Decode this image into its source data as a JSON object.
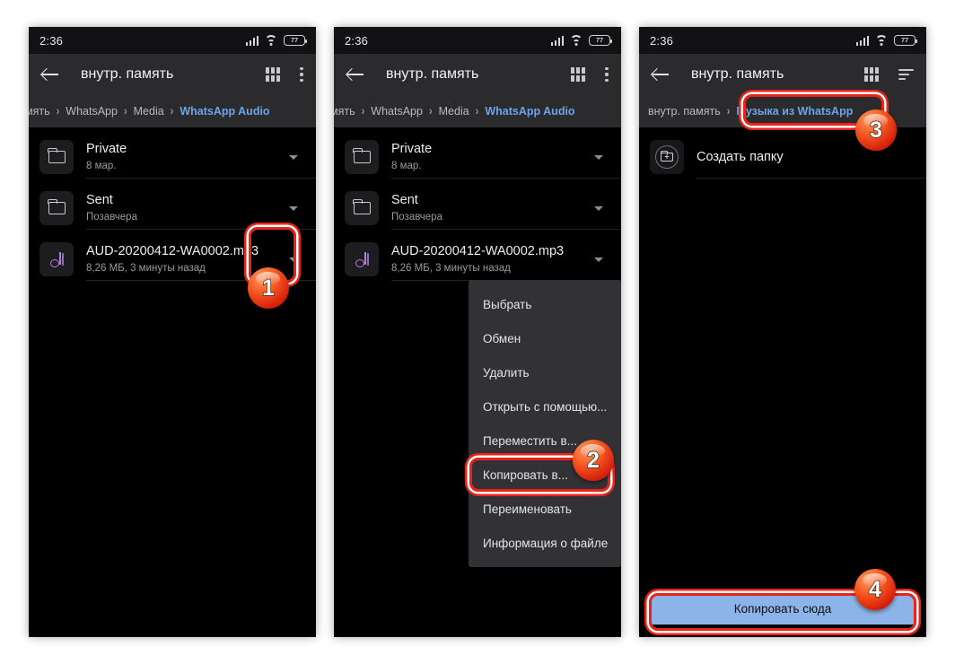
{
  "status_bar": {
    "time": "2:36",
    "battery_level": "77",
    "icons": [
      "signal-icon",
      "wifi-icon",
      "battery-icon"
    ]
  },
  "panel1": {
    "appbar": {
      "title": "внутр. память",
      "back_icon": "back-arrow-icon",
      "grid_icon": "grid-view-icon",
      "overflow_icon": "more-vertical-icon"
    },
    "breadcrumb": [
      {
        "label": "мять",
        "active": false
      },
      {
        "label": "WhatsApp",
        "active": false
      },
      {
        "label": "Media",
        "active": false
      },
      {
        "label": "WhatsApp Audio",
        "active": true
      }
    ],
    "rows": [
      {
        "icon": "folder-icon",
        "title": "Private",
        "subtitle": "8 мар."
      },
      {
        "icon": "folder-icon",
        "title": "Sent",
        "subtitle": "Позавчера"
      },
      {
        "icon": "music-note-icon",
        "title": "AUD-20200412-WA0002.mp3",
        "subtitle": "8,26 МБ, 3 минуты назад"
      }
    ]
  },
  "panel2": {
    "appbar": {
      "title": "внутр. память",
      "back_icon": "back-arrow-icon",
      "grid_icon": "grid-view-icon",
      "overflow_icon": "more-vertical-icon"
    },
    "breadcrumb": [
      {
        "label": "мять",
        "active": false
      },
      {
        "label": "WhatsApp",
        "active": false
      },
      {
        "label": "Media",
        "active": false
      },
      {
        "label": "WhatsApp Audio",
        "active": true
      }
    ],
    "rows": [
      {
        "icon": "folder-icon",
        "title": "Private",
        "subtitle": "8 мар."
      },
      {
        "icon": "folder-icon",
        "title": "Sent",
        "subtitle": "Позавчера"
      },
      {
        "icon": "music-note-icon",
        "title": "AUD-20200412-WA0002.mp3",
        "subtitle": "8,26 МБ, 3 минуты назад"
      }
    ],
    "context_menu": [
      "Выбрать",
      "Обмен",
      "Удалить",
      "Открыть с помощью...",
      "Переместить в...",
      "Копировать в...",
      "Переименовать",
      "Информация о файле"
    ]
  },
  "panel3": {
    "appbar": {
      "title": "внутр. память",
      "back_icon": "back-arrow-icon",
      "grid_icon": "grid-view-icon",
      "sort_icon": "sort-icon"
    },
    "breadcrumb": [
      {
        "label": "внутр. память",
        "active": false
      },
      {
        "label": "Музыка из WhatsApp",
        "active": true
      }
    ],
    "create_folder": {
      "icon": "new-folder-icon",
      "label": "Создать папку"
    },
    "primary_button": "Копировать сюда"
  },
  "annotations": {
    "badges": [
      "1",
      "2",
      "3",
      "4"
    ],
    "highlight_color": "#e8231a",
    "badge_color": "#e8440f"
  }
}
